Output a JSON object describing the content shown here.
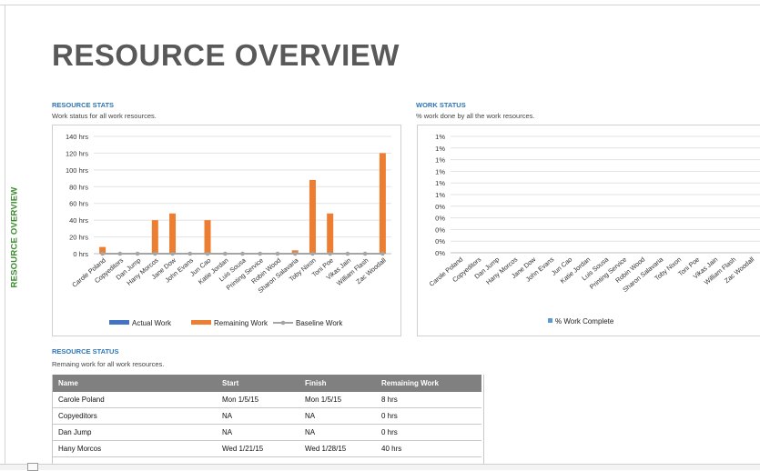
{
  "side_label": "RESOURCE OVERVIEW",
  "page_title": "RESOURCE OVERVIEW",
  "stats": {
    "title": "RESOURCE STATS",
    "subtitle": "Work status for all work resources."
  },
  "work_status": {
    "title": "WORK STATUS",
    "subtitle": "% work done by all the work resources."
  },
  "resource_status": {
    "title": "RESOURCE STATUS",
    "subtitle": "Remaing work for all work resources.",
    "columns": [
      "Name",
      "Start",
      "Finish",
      "Remaining Work"
    ],
    "rows": [
      [
        "Carole Poland",
        "Mon 1/5/15",
        "Mon 1/5/15",
        "8 hrs"
      ],
      [
        "Copyeditors",
        "NA",
        "NA",
        "0 hrs"
      ],
      [
        "Dan Jump",
        "NA",
        "NA",
        "0 hrs"
      ],
      [
        "Hany Morcos",
        "Wed 1/21/15",
        "Wed 1/28/15",
        "40 hrs"
      ]
    ]
  },
  "chart_data": [
    {
      "type": "bar",
      "categories": [
        "Carole Poland",
        "Copyeditors",
        "Dan Jump",
        "Hany Morcos",
        "Jane Dow",
        "John Evans",
        "Jun Cao",
        "Katie Jordan",
        "Luis Sousa",
        "Printing Service",
        "Robin Wood",
        "Sharon Salavaria",
        "Toby Nixon",
        "Toni Poe",
        "Vikas Jain",
        "William Flash",
        "Zac Woodall"
      ],
      "series": [
        {
          "name": "Actual Work",
          "color": "#4472c4",
          "values": [
            0,
            0,
            0,
            0,
            0,
            0,
            0,
            0,
            0,
            0,
            0,
            0,
            0,
            0,
            0,
            0,
            0
          ]
        },
        {
          "name": "Remaining Work",
          "color": "#ed7d31",
          "values": [
            8,
            0,
            0,
            40,
            48,
            0,
            40,
            0,
            0,
            0,
            0,
            4,
            88,
            48,
            0,
            0,
            120
          ]
        },
        {
          "name": "Baseline Work",
          "color": "#a5a5a5",
          "values": [
            0,
            0,
            0,
            0,
            0,
            0,
            0,
            0,
            0,
            0,
            0,
            0,
            0,
            0,
            0,
            0,
            0
          ]
        }
      ],
      "yticks": [
        "0 hrs",
        "20 hrs",
        "40 hrs",
        "60 hrs",
        "80 hrs",
        "100 hrs",
        "120 hrs",
        "140 hrs"
      ],
      "ylim": [
        0,
        140
      ],
      "legend": "bottom"
    },
    {
      "type": "bar",
      "categories": [
        "Carole Poland",
        "Copyeditors",
        "Dan Jump",
        "Hany Morcos",
        "Jane Dow",
        "John Evans",
        "Jun Cao",
        "Katie Jordan",
        "Luis Sousa",
        "Printing Service",
        "Robin Wood",
        "Sharon Salavaria",
        "Toby Nixon",
        "Toni Poe",
        "Vikas Jain",
        "William Flash",
        "Zac Woodall"
      ],
      "series": [
        {
          "name": "% Work Complete",
          "color": "#5b9bd5",
          "values": [
            0,
            0,
            0,
            0,
            0,
            0,
            0,
            0,
            0,
            0,
            0,
            0,
            0,
            0,
            0,
            0,
            0
          ]
        }
      ],
      "yticks": [
        "0%",
        "0%",
        "0%",
        "0%",
        "0%",
        "1%",
        "1%",
        "1%",
        "1%",
        "1%",
        "1%"
      ],
      "ylim": [
        0,
        1
      ],
      "legend": "bottom"
    }
  ]
}
